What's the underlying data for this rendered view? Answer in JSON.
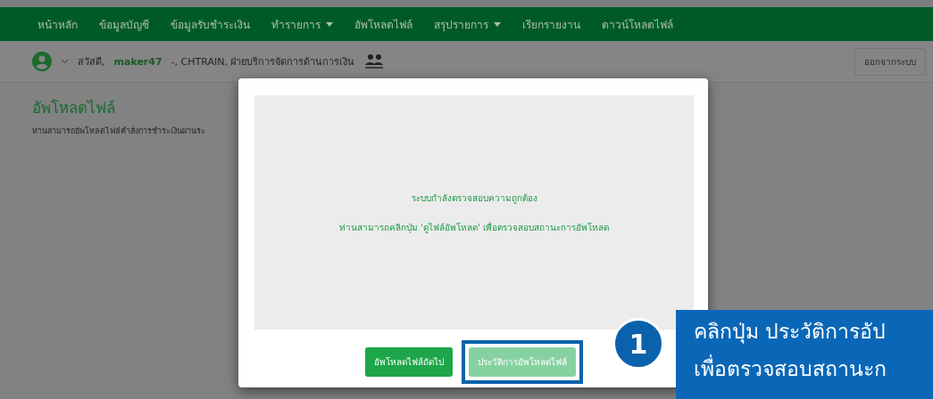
{
  "nav": {
    "items": [
      {
        "label": "หน้าหลัก",
        "dropdown": false
      },
      {
        "label": "ข้อมูลบัญชี",
        "dropdown": false
      },
      {
        "label": "ข้อมูลรับชำระเงิน",
        "dropdown": false
      },
      {
        "label": "ทำรายการ",
        "dropdown": true
      },
      {
        "label": "อัพโหลดไฟล์",
        "dropdown": false
      },
      {
        "label": "สรุปรายการ",
        "dropdown": true
      },
      {
        "label": "เรียกรายงาน",
        "dropdown": false
      },
      {
        "label": "ดาวน์โหลดไฟล์",
        "dropdown": false
      }
    ]
  },
  "user_bar": {
    "greeting": "สวัสดี,",
    "username": "maker47",
    "details": "-, CHTRAIN, ฝ่ายบริการจัดการด้านการเงิน",
    "logout": "ออกจากระบบ"
  },
  "page": {
    "title": "อัพโหลดไฟล์",
    "subtitle": "ท่านสามารถอัพโหลดไฟล์คำสั่งการชำระเงินผ่านระ"
  },
  "modal": {
    "messages": [
      "ระบบกำลังตรวจสอบความถูกต้อง",
      "ท่านสามารถคลิกปุ่ม 'ดูไฟล์อัพโหลด' เพื่อตรวจสอบสถานะการอัพโหลด"
    ],
    "buttons": [
      {
        "label": "อัพโหลดไฟล์ถัดไป",
        "kind": "solid",
        "highlighted": false
      },
      {
        "label": "ประวัติการอัพโหลดไฟล์",
        "kind": "light",
        "highlighted": true
      }
    ]
  },
  "callout": {
    "number": "1",
    "lines": [
      "คลิกปุ่ม ประวัติการอัป",
      "เพื่อตรวจสอบสถานะก"
    ]
  }
}
